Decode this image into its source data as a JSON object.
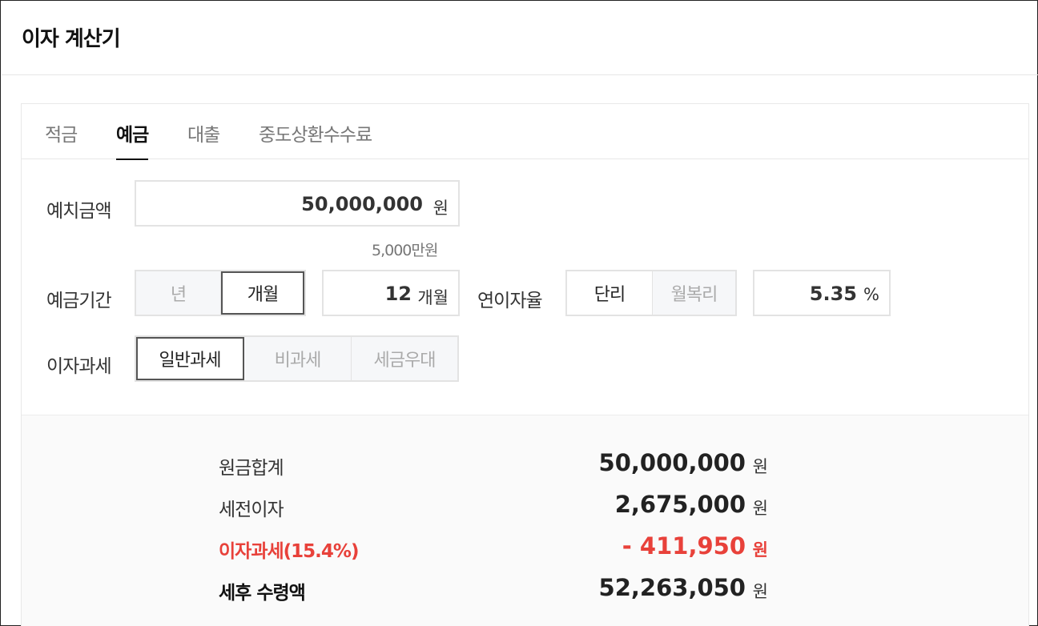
{
  "header": {
    "title": "이자 계산기"
  },
  "tabs": [
    {
      "label": "적금",
      "active": false
    },
    {
      "label": "예금",
      "active": true
    },
    {
      "label": "대출",
      "active": false
    },
    {
      "label": "중도상환수수료",
      "active": false
    }
  ],
  "deposit": {
    "label": "예치금액",
    "value": "50,000,000",
    "unit": "원",
    "hint": "5,000만원"
  },
  "period": {
    "label": "예금기간",
    "options": [
      {
        "label": "년",
        "selected": false
      },
      {
        "label": "개월",
        "selected": true
      }
    ],
    "value": "12",
    "unit": "개월"
  },
  "rate": {
    "label": "연이자율",
    "options": [
      {
        "label": "단리",
        "selected": true
      },
      {
        "label": "월복리",
        "selected": false
      }
    ],
    "value": "5.35",
    "unit": "%"
  },
  "tax_type": {
    "label": "이자과세",
    "options": [
      {
        "label": "일반과세",
        "selected": true
      },
      {
        "label": "비과세",
        "selected": false
      },
      {
        "label": "세금우대",
        "selected": false
      }
    ]
  },
  "results": {
    "principal": {
      "label": "원금합계",
      "value": "50,000,000",
      "unit": "원"
    },
    "pretax_interest": {
      "label": "세전이자",
      "value": "2,675,000",
      "unit": "원"
    },
    "tax": {
      "label": "이자과세(15.4%)",
      "value": "- 411,950",
      "unit": "원"
    },
    "net": {
      "label": "세후 수령액",
      "value": "52,263,050",
      "unit": "원"
    }
  },
  "colors": {
    "tax_red": "#e8413a",
    "text": "#222222",
    "border": "#e3e3e3"
  }
}
